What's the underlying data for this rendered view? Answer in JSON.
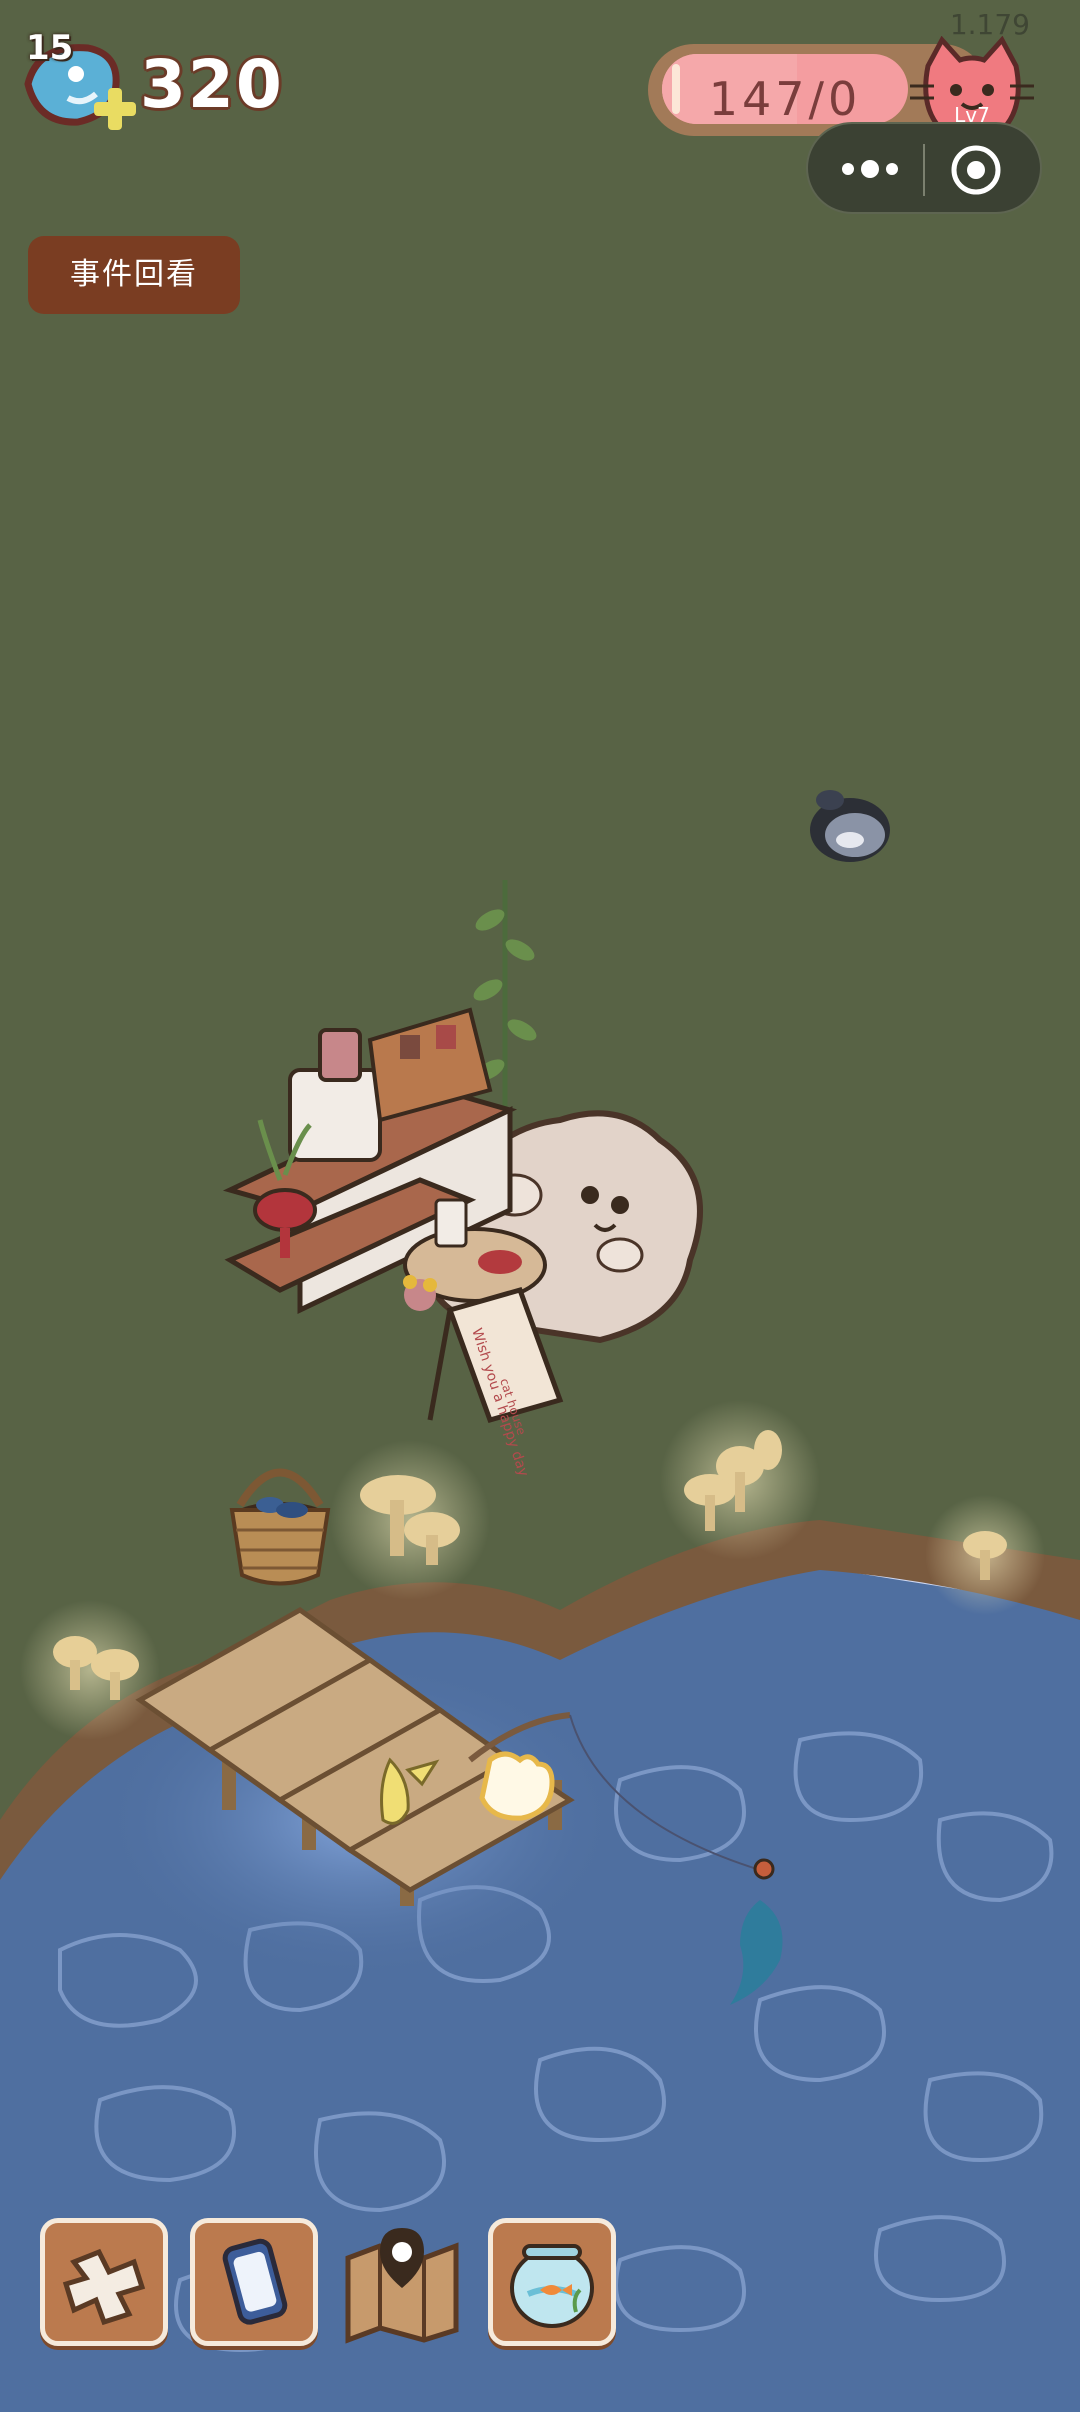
{
  "hud": {
    "fish_level": "15",
    "fish_amount": "320",
    "version": "1.179",
    "progress_text": "147/0",
    "progress_level_label": "Lv7",
    "progress_fraction": 0.55
  },
  "capsule": {
    "more_icon": "ellipsis-icon",
    "close_icon": "target-circle-icon"
  },
  "event_button": {
    "label": "事件回看"
  },
  "scene": {
    "sign_text": "Wish you a happy day",
    "sign_footer": "cat house"
  },
  "toolbar": {
    "items": [
      {
        "icon": "puzzle-icon"
      },
      {
        "icon": "phone-icon"
      },
      {
        "icon": "map-icon"
      },
      {
        "icon": "fishbowl-icon"
      }
    ]
  },
  "colors": {
    "grass": "#586345",
    "water": "#4f6fa0",
    "progress_pink": "#f49da0",
    "button_brown": "#7a3d22"
  }
}
